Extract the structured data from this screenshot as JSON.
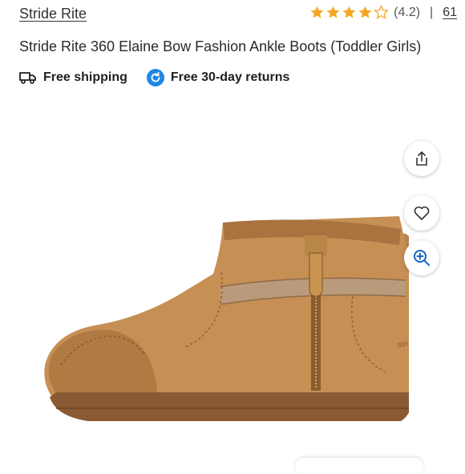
{
  "header": {
    "brand": "Stride Rite",
    "rating_value": "(4.2)",
    "rating_stars": 4.2,
    "separator": "|",
    "review_count": "61"
  },
  "product": {
    "title": "Stride Rite 360 Elaine Bow Fashion Ankle Boots (Toddler Girls)"
  },
  "badges": {
    "shipping": "Free shipping",
    "returns": "Free 30-day returns"
  },
  "colors": {
    "star": "#f5a623",
    "returns_icon": "#1e88e5",
    "zoom_icon": "#1565c0"
  },
  "gallery": {
    "image_desc_icon": "toddler-ankle-boot-image",
    "share": "share-icon",
    "favorite": "heart-icon",
    "zoom": "zoom-in-icon"
  }
}
